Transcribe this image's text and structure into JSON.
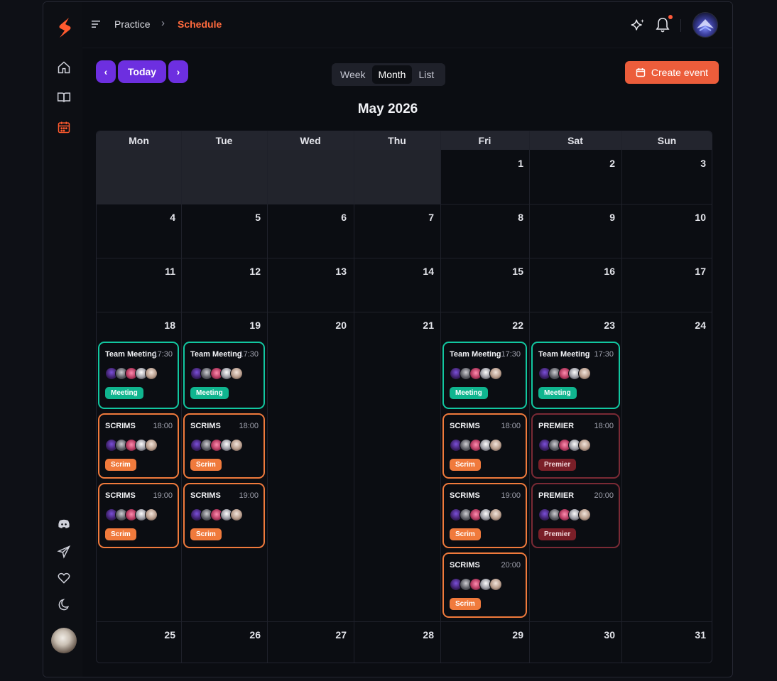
{
  "breadcrumb": {
    "parent": "Practice",
    "separator": "›",
    "current": "Schedule"
  },
  "toolbar": {
    "prev": "‹",
    "today": "Today",
    "next": "›",
    "create_event": "Create event"
  },
  "views": {
    "week": "Week",
    "month": "Month",
    "list": "List"
  },
  "calendar_title": "May 2026",
  "weekdays": [
    "Mon",
    "Tue",
    "Wed",
    "Thu",
    "Fri",
    "Sat",
    "Sun"
  ],
  "days": [
    "1",
    "2",
    "3",
    "4",
    "5",
    "6",
    "7",
    "8",
    "9",
    "10",
    "11",
    "12",
    "13",
    "14",
    "15",
    "16",
    "17",
    "18",
    "19",
    "20",
    "21",
    "22",
    "23",
    "24",
    "25",
    "26",
    "27",
    "28",
    "29",
    "30",
    "31"
  ],
  "colors": {
    "accent": "#ff6a3d",
    "primary": "#6d2fe0",
    "meeting": "#12c7a0",
    "scrim": "#f07a3c",
    "premier": "#7a2a35"
  },
  "events": [
    {
      "title": "Team Meeting",
      "time": "17:30",
      "badge": "Meeting"
    },
    {
      "title": "Team Meeting",
      "time": "17:30",
      "badge": "Meeting"
    },
    {
      "title": "Team Meeting",
      "time": "17:30",
      "badge": "Meeting"
    },
    {
      "title": "Team Meeting",
      "time": "17:30",
      "badge": "Meeting"
    },
    {
      "title": "SCRIMS",
      "time": "18:00",
      "badge": "Scrim"
    },
    {
      "title": "SCRIMS",
      "time": "18:00",
      "badge": "Scrim"
    },
    {
      "title": "SCRIMS",
      "time": "18:00",
      "badge": "Scrim"
    },
    {
      "title": "PREMIER",
      "time": "18:00",
      "badge": "Premier"
    },
    {
      "title": "SCRIMS",
      "time": "19:00",
      "badge": "Scrim"
    },
    {
      "title": "SCRIMS",
      "time": "19:00",
      "badge": "Scrim"
    },
    {
      "title": "SCRIMS",
      "time": "19:00",
      "badge": "Scrim"
    },
    {
      "title": "PREMIER",
      "time": "20:00",
      "badge": "Premier"
    },
    {
      "title": "SCRIMS",
      "time": "20:00",
      "badge": "Scrim"
    }
  ]
}
